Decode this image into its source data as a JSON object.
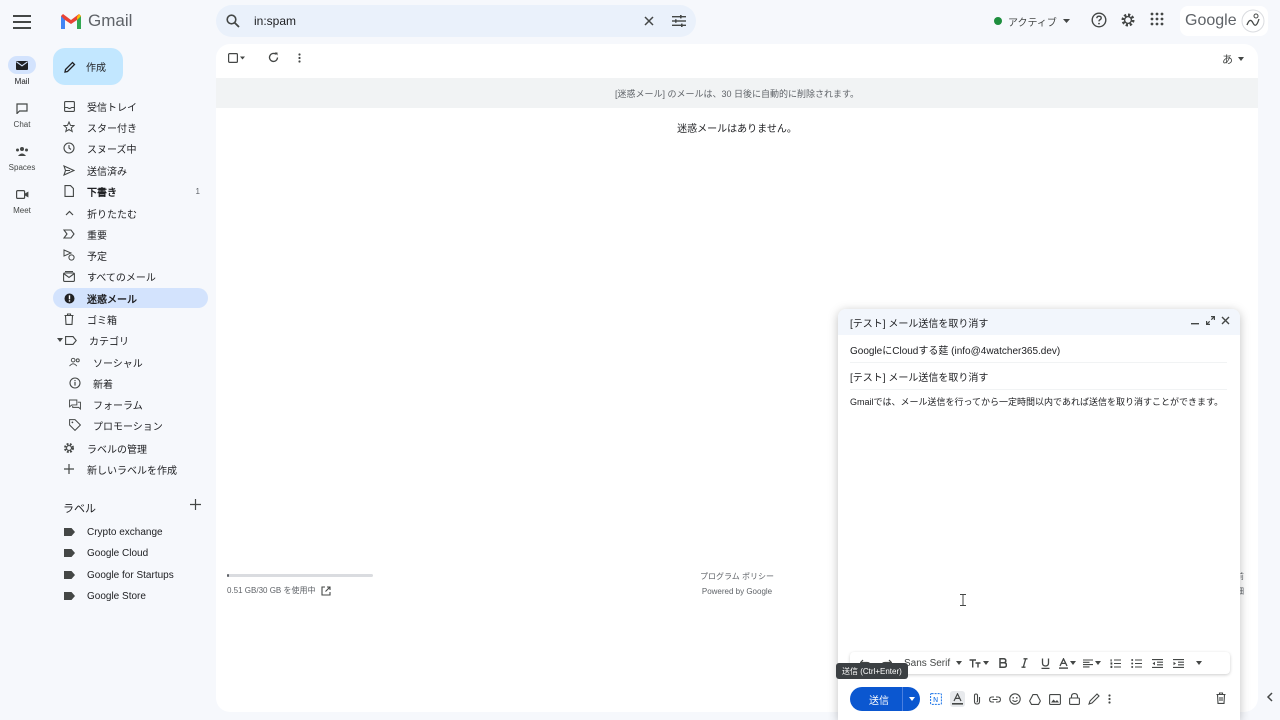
{
  "header": {
    "app_name": "Gmail",
    "search_value": "in:spam",
    "status_label": "アクティブ",
    "account_brand": "Google"
  },
  "rail": [
    {
      "label": "Mail",
      "icon": "mail-icon",
      "active": true
    },
    {
      "label": "Chat",
      "icon": "chat-icon"
    },
    {
      "label": "Spaces",
      "icon": "spaces-icon"
    },
    {
      "label": "Meet",
      "icon": "meet-icon"
    }
  ],
  "compose_label": "作成",
  "nav": {
    "inbox": "受信トレイ",
    "starred": "スター付き",
    "snoozed": "スヌーズ中",
    "sent": "送信済み",
    "drafts": "下書き",
    "drafts_count": "1",
    "collapse": "折りたたむ",
    "important": "重要",
    "scheduled": "予定",
    "all_mail": "すべてのメール",
    "spam": "迷惑メール",
    "trash": "ゴミ箱",
    "categories": "カテゴリ",
    "social": "ソーシャル",
    "updates": "新着",
    "forums": "フォーラム",
    "promotions": "プロモーション",
    "manage_labels": "ラベルの管理",
    "create_label": "新しいラベルを作成"
  },
  "labels": {
    "heading": "ラベル",
    "items": [
      "Crypto exchange",
      "Google Cloud",
      "Google for Startups",
      "Google Store"
    ]
  },
  "main": {
    "input_tool": "あ",
    "banner": "[迷惑メール] のメールは、30 日後に自動的に削除されます。",
    "empty_message": "迷惑メールはありません。",
    "storage_text": "0.51 GB/30 GB を使用中",
    "storage_fraction": 0.017,
    "program_policy": "プログラム ポリシー",
    "powered_by": "Powered by Google",
    "right_fragment_1": "前",
    "right_fragment_2": "細"
  },
  "compose": {
    "title": "[テスト] メール送信を取り消す",
    "to": "GoogleにCloudする莚 (info@4watcher365.dev)",
    "subject": "[テスト] メール送信を取り消す",
    "body": "Gmailでは、メール送信を行ってから一定時間以内であれば送信を取り消すことができます。",
    "font_name": "Sans Serif",
    "send_label": "送信",
    "tooltip": "送信 (Ctrl+Enter)",
    "colors": {
      "send": "#0b57d0"
    }
  }
}
